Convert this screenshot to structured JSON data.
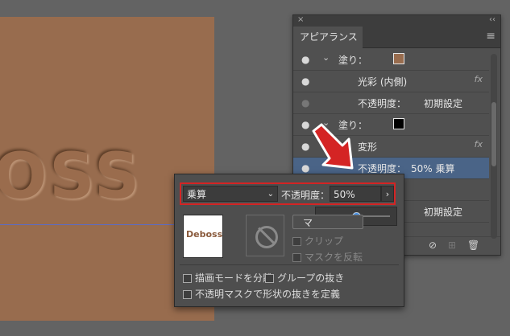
{
  "canvas": {
    "emboss_text": "OSS"
  },
  "panel": {
    "close": "×",
    "collapse": "‹‹",
    "tab": "アピアランス",
    "menu": "≡",
    "rows": [
      {
        "label": "塗り：",
        "swatch": "#986c4e",
        "chevron": "⌄"
      },
      {
        "label": "光彩 (内側)",
        "fx": "fx"
      },
      {
        "label": "不透明度：",
        "value": "初期設定"
      },
      {
        "label": "塗り：",
        "swatch": "#000000",
        "chevron": "⌄"
      },
      {
        "label": "変形",
        "fx": "fx"
      },
      {
        "label": "不透明度：",
        "value": "50% 乗算"
      },
      {
        "label": "",
        "value": ""
      },
      {
        "label": "",
        "value": "初期設定"
      }
    ]
  },
  "popup": {
    "blend_mode": "乗算",
    "opacity_label": "不透明度：",
    "opacity_value": "50%",
    "opacity_btn": "›",
    "slider_level": 0.5,
    "thumb_text": "Deboss",
    "make_mask_btn": "マ",
    "clip_label": "クリップ",
    "invert_label": "マスクを反転",
    "isolate_label": "描画モードを分離",
    "knockout_label": "グループの抜き",
    "opacity_knockout_label": "不透明マスクで形状の抜きを定義"
  },
  "colors": {
    "highlight": "#d42424",
    "accent": "#3e8de8"
  }
}
